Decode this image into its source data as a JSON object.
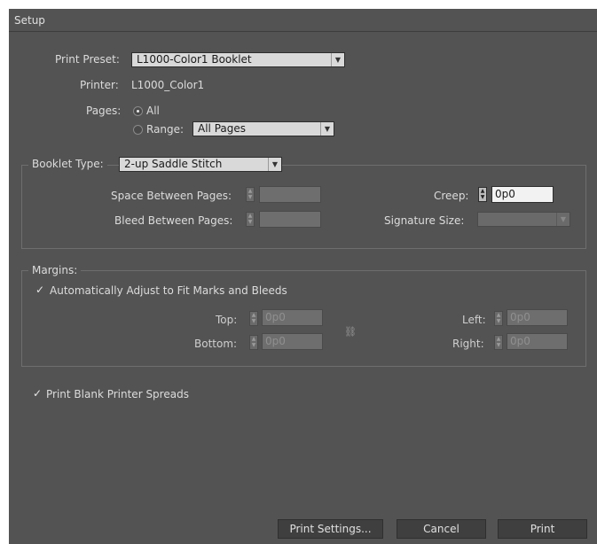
{
  "dialog": {
    "title": "Setup"
  },
  "preset": {
    "label": "Print Preset:",
    "value": "L1000-Color1 Booklet"
  },
  "printer": {
    "label": "Printer:",
    "value": "L1000_Color1"
  },
  "pages": {
    "label": "Pages:",
    "all_label": "All",
    "range_label": "Range:",
    "range_value": "All Pages",
    "selected": "All"
  },
  "booklet": {
    "type_label": "Booklet Type:",
    "type_value": "2-up Saddle Stitch",
    "space_between_label": "Space Between Pages:",
    "space_between_value": "",
    "bleed_between_label": "Bleed Between Pages:",
    "bleed_between_value": "",
    "creep_label": "Creep:",
    "creep_value": "0p0",
    "signature_label": "Signature Size:",
    "signature_value": ""
  },
  "margins": {
    "legend": "Margins:",
    "auto_adjust_label": "Automatically Adjust to Fit Marks and Bleeds",
    "auto_adjust_checked": true,
    "top_label": "Top:",
    "top_value": "0p0",
    "bottom_label": "Bottom:",
    "bottom_value": "0p0",
    "left_label": "Left:",
    "left_value": "0p0",
    "right_label": "Right:",
    "right_value": "0p0"
  },
  "print_blank": {
    "label": "Print Blank Printer Spreads",
    "checked": true
  },
  "buttons": {
    "print_settings": "Print Settings...",
    "cancel": "Cancel",
    "print": "Print"
  },
  "icons": {
    "dropdown": "chevron-down-icon",
    "chain": "chain-link-icon",
    "check": "checkmark-icon"
  }
}
